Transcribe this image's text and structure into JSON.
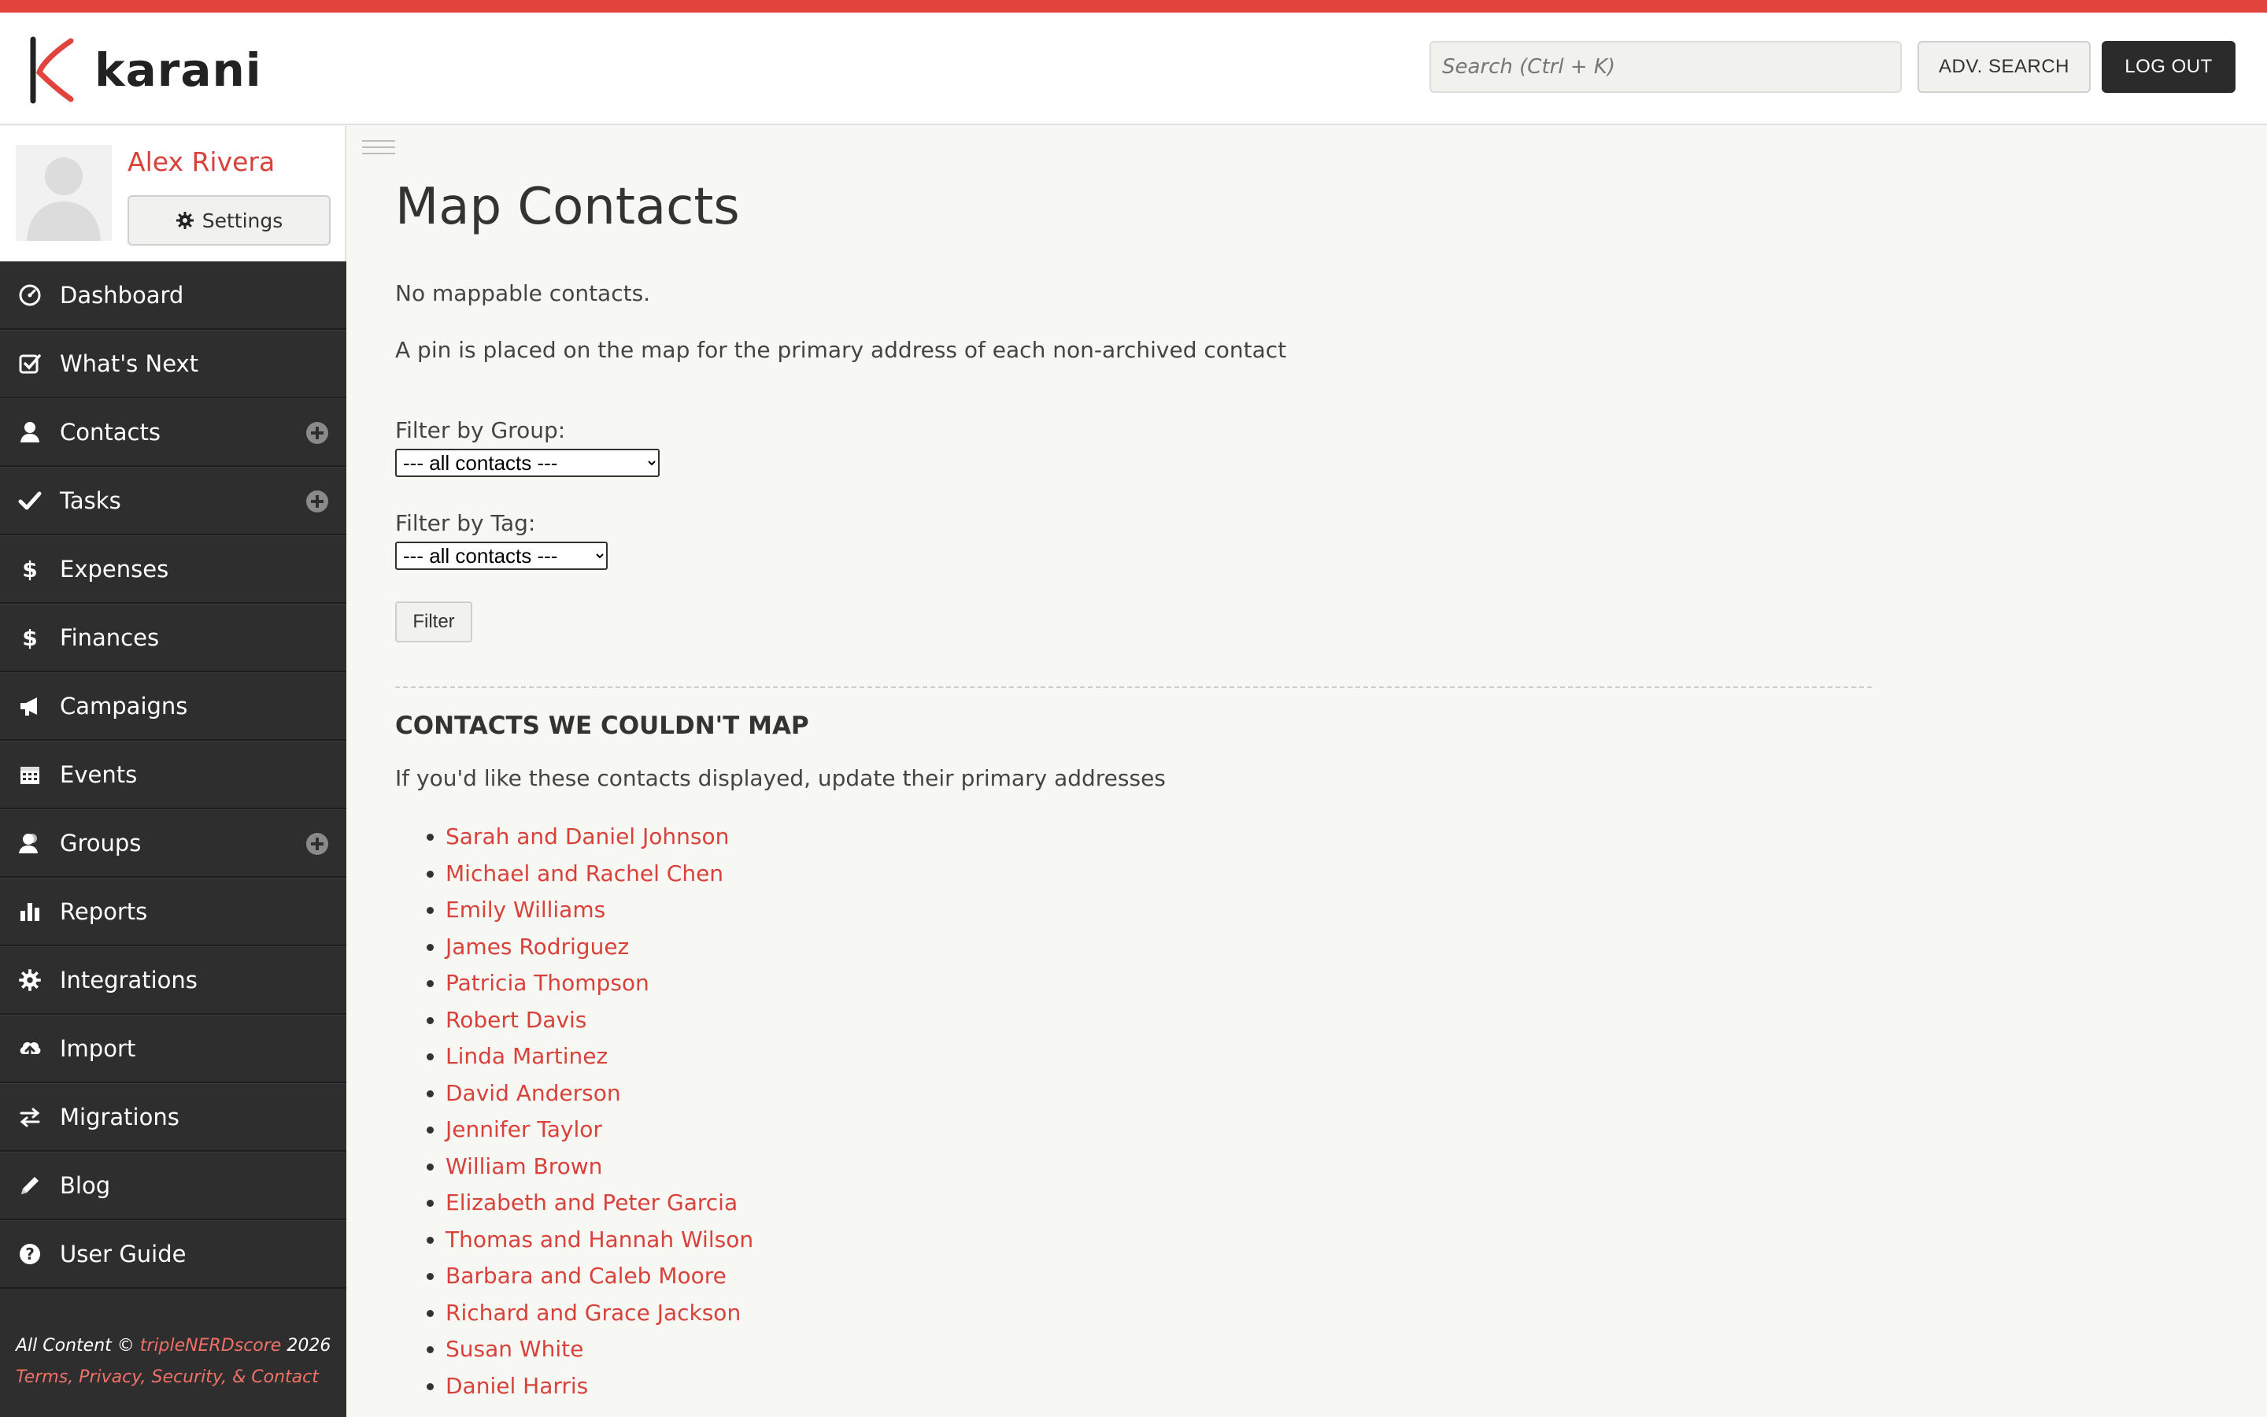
{
  "app": {
    "name": "karani",
    "accent": "#e0443c",
    "dark": "#2e2e2e"
  },
  "header": {
    "search_placeholder": "Search (Ctrl + K)",
    "adv_search_label": "ADV. SEARCH",
    "logout_label": "LOG OUT"
  },
  "profile": {
    "name": "Alex Rivera",
    "settings_label": "Settings"
  },
  "nav": {
    "items": [
      {
        "label": "Dashboard",
        "icon": "dashboard-icon",
        "plus": false
      },
      {
        "label": "What's Next",
        "icon": "check-square-icon",
        "plus": false
      },
      {
        "label": "Contacts",
        "icon": "user-icon",
        "plus": true
      },
      {
        "label": "Tasks",
        "icon": "check-icon",
        "plus": true
      },
      {
        "label": "Expenses",
        "icon": "dollar-icon",
        "plus": false
      },
      {
        "label": "Finances",
        "icon": "dollar-icon",
        "plus": false
      },
      {
        "label": "Campaigns",
        "icon": "megaphone-icon",
        "plus": false
      },
      {
        "label": "Events",
        "icon": "calendar-icon",
        "plus": false
      },
      {
        "label": "Groups",
        "icon": "group-icon",
        "plus": true
      },
      {
        "label": "Reports",
        "icon": "bar-chart-icon",
        "plus": false
      },
      {
        "label": "Integrations",
        "icon": "gear-icon",
        "plus": false
      },
      {
        "label": "Import",
        "icon": "cloud-upload-icon",
        "plus": false
      },
      {
        "label": "Migrations",
        "icon": "exchange-icon",
        "plus": false
      },
      {
        "label": "Blog",
        "icon": "pencil-icon",
        "plus": false
      },
      {
        "label": "User Guide",
        "icon": "question-icon",
        "plus": false
      }
    ]
  },
  "footer": {
    "prefix": "All Content © ",
    "owner": "tripleNERDscore",
    "year": " 2026",
    "links": "Terms, Privacy, Security, & Contact"
  },
  "main": {
    "title": "Map Contacts",
    "no_contacts": "No mappable contacts.",
    "description": "A pin is placed on the map for the primary address of each non-archived contact",
    "group_label": "Filter by Group:",
    "group_selected": "--- all contacts ---",
    "tag_label": "Filter by Tag:",
    "tag_selected": "--- all contacts ---",
    "filter_button": "Filter",
    "section_title": "CONTACTS WE COULDN'T MAP",
    "section_hint": "If you'd like these contacts displayed, update their primary addresses",
    "contacts": [
      "Sarah and Daniel Johnson",
      "Michael and Rachel Chen",
      "Emily Williams",
      "James Rodriguez",
      "Patricia Thompson",
      "Robert Davis",
      "Linda Martinez",
      "David Anderson",
      "Jennifer Taylor",
      "William Brown",
      "Elizabeth and Peter Garcia",
      "Thomas and Hannah Wilson",
      "Barbara and Caleb Moore",
      "Richard and Grace Jackson",
      "Susan White",
      "Daniel Harris"
    ]
  }
}
